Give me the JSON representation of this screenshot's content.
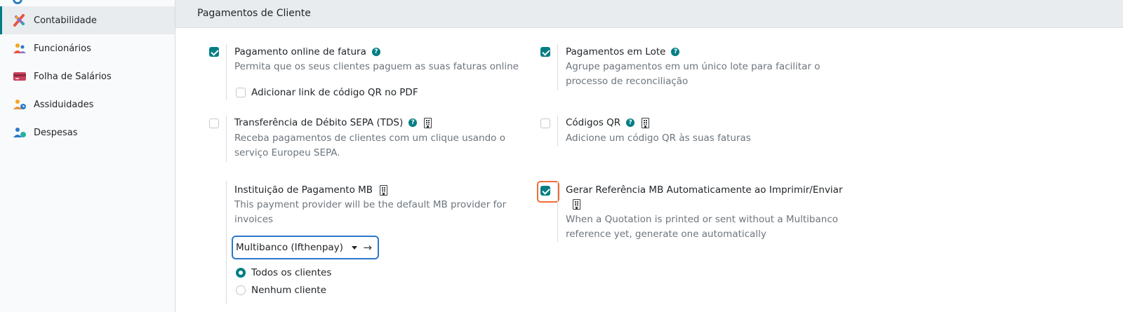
{
  "sidebar": {
    "items": [
      {
        "label": "Contabilidade",
        "icon": "accounting-icon",
        "active": true
      },
      {
        "label": "Funcionários",
        "icon": "employees-icon",
        "active": false
      },
      {
        "label": "Folha de Salários",
        "icon": "payroll-icon",
        "active": false
      },
      {
        "label": "Assiduidades",
        "icon": "attendance-icon",
        "active": false
      },
      {
        "label": "Despesas",
        "icon": "expenses-icon",
        "active": false
      }
    ]
  },
  "section": {
    "title": "Pagamentos de Cliente"
  },
  "settings": {
    "online_payment": {
      "title": "Pagamento online de fatura",
      "desc": "Permita que os seus clientes paguem as suas faturas online",
      "checked": true,
      "sub_option": {
        "label": "Adicionar link de código QR no PDF",
        "checked": false
      }
    },
    "batch_payments": {
      "title": "Pagamentos em Lote",
      "desc_line1": "Agrupe pagamentos em um único lote para facilitar o",
      "desc_line2": "processo de reconciliação",
      "checked": true
    },
    "sepa": {
      "title": "Transferência de Débito SEPA (TDS)",
      "desc_line1": "Receba pagamentos de clientes com um clique usando o",
      "desc_line2": "serviço Europeu SEPA.",
      "checked": false
    },
    "qr_codes": {
      "title": "Códigos QR",
      "desc": "Adicione um código QR às suas faturas",
      "checked": false
    },
    "mb_institution": {
      "title": "Instituição de Pagamento MB",
      "desc_line1": "This payment provider will be the default MB provider for",
      "desc_line2": "invoices",
      "select_value": "Multibanco (Ifthenpay)",
      "radio_options": [
        {
          "label": "Todos os clientes",
          "selected": true
        },
        {
          "label": "Nenhum cliente",
          "selected": false
        }
      ]
    },
    "mb_auto_ref": {
      "title": "Gerar Referência MB Automaticamente ao Imprimir/Enviar",
      "desc_line1": "When a Quotation is printed or sent without a Multibanco",
      "desc_line2": "reference yet, generate one automatically",
      "checked": true
    }
  },
  "colors": {
    "accent": "#017e84",
    "focus_blue": "#2b78c8",
    "highlight": "#f06d36"
  }
}
